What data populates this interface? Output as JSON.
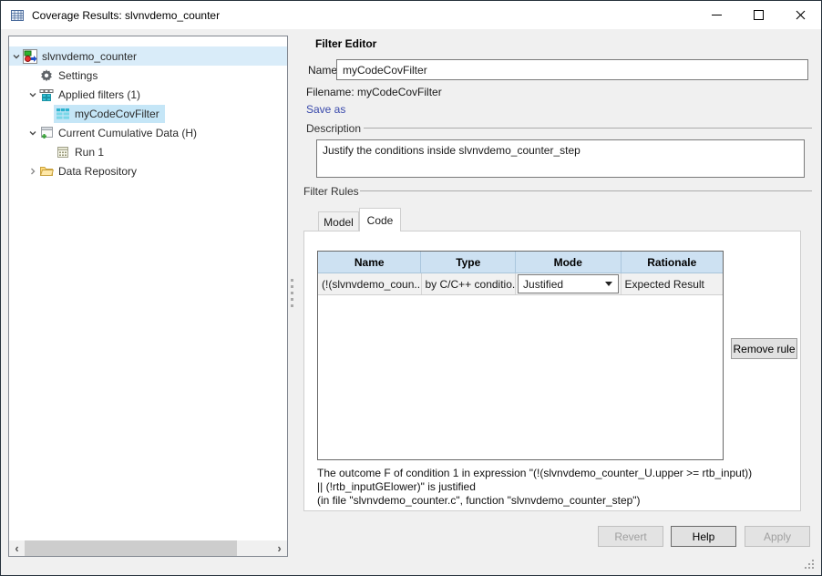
{
  "window": {
    "title": "Coverage Results: slvnvdemo_counter",
    "controls": [
      {
        "name": "minimize"
      },
      {
        "name": "maximize"
      },
      {
        "name": "close"
      }
    ]
  },
  "colors": {
    "link": "#3949ab",
    "tree_selection": "#c5e6f7",
    "tree_row_highlight": "#d9ecf9",
    "table_header_bg": "#cde1f2",
    "dialog_bg": "#f0f0f0",
    "titlebar_bg": "#ffffff"
  },
  "tree": {
    "items": [
      {
        "label": "slvnvdemo_counter",
        "level": 0,
        "chevron": "down",
        "icon": "model-icon",
        "row_highlight": true
      },
      {
        "label": "Settings",
        "level": 1,
        "chevron": "none",
        "icon": "gear-icon"
      },
      {
        "label": "Applied filters (1)",
        "level": 1,
        "chevron": "down",
        "icon": "applied-filters-icon"
      },
      {
        "label": "myCodeCovFilter",
        "level": 2,
        "chevron": "none",
        "icon": "filter-icon",
        "selected": true
      },
      {
        "label": "Current Cumulative Data (H)",
        "level": 1,
        "chevron": "down",
        "icon": "cumulative-data-icon"
      },
      {
        "label": "Run 1",
        "level": 2,
        "chevron": "none",
        "icon": "run-icon"
      },
      {
        "label": "Data Repository",
        "level": 1,
        "chevron": "right",
        "icon": "folder-icon"
      }
    ]
  },
  "editor": {
    "title": "Filter Editor",
    "name_label": "Name",
    "name_value": "myCodeCovFilter",
    "filename_text": "Filename: myCodeCovFilter",
    "save_as_label": "Save as",
    "description_label": "Description",
    "description_value": "Justify the conditions inside slvnvdemo_counter_step",
    "filter_rules_label": "Filter Rules",
    "tabs": [
      {
        "label": "Model",
        "active": false
      },
      {
        "label": "Code",
        "active": true
      }
    ],
    "table": {
      "columns": [
        "Name",
        "Type",
        "Mode",
        "Rationale"
      ],
      "rows": [
        {
          "name": "(!(slvnvdemo_coun...",
          "type": "by C/C++ conditio...",
          "mode": "Justified",
          "rationale": "Expected Result"
        }
      ]
    },
    "remove_rule_label": "Remove rule",
    "outcome_lines": [
      "The outcome F of condition 1 in expression \"(!(slvnvdemo_counter_U.upper >= rtb_input))",
      "|| (!rtb_inputGElower)\" is justified",
      "(in file \"slvnvdemo_counter.c\", function \"slvnvdemo_counter_step\")"
    ],
    "buttons": [
      {
        "label": "Revert",
        "enabled": false
      },
      {
        "label": "Help",
        "enabled": true
      },
      {
        "label": "Apply",
        "enabled": false
      }
    ]
  }
}
